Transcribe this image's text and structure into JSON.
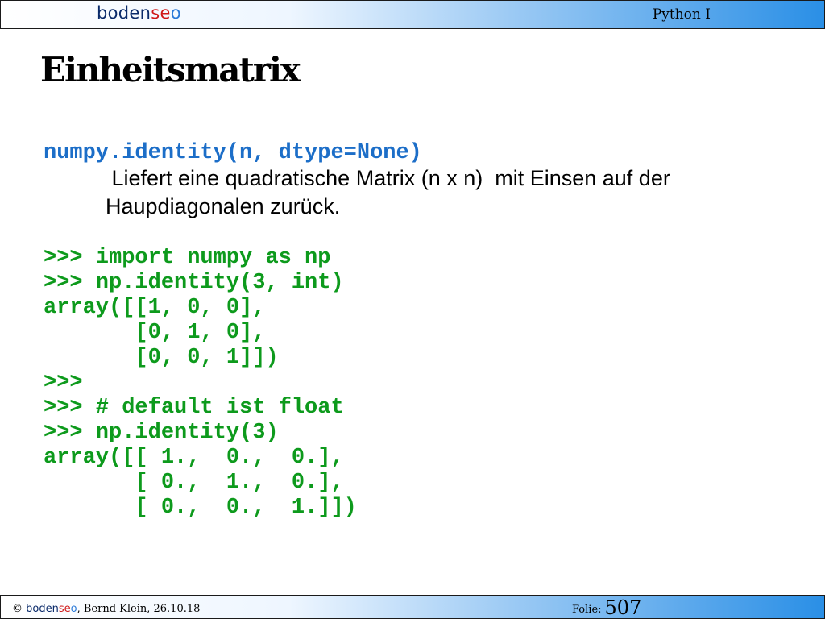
{
  "header": {
    "brand": {
      "part1": "boden",
      "part2": "se",
      "part3": "o"
    },
    "course": "Python I"
  },
  "slide": {
    "title": "Einheitsmatrix",
    "signature": "numpy.identity(n, dtype=None)",
    "description_lines": [
      " Liefert eine quadratische Matrix (n x n)  mit Einsen auf der",
      "Haupdiagonalen zurück."
    ],
    "code_lines": [
      ">>> import numpy as np",
      ">>> np.identity(3, int)",
      "array([[1, 0, 0],",
      "       [0, 1, 0],",
      "       [0, 0, 1]])",
      ">>>",
      ">>> # default ist float",
      ">>> np.identity(3)",
      "array([[ 1.,  0.,  0.],",
      "       [ 0.,  1.,  0.],",
      "       [ 0.,  0.,  1.]])"
    ]
  },
  "footer": {
    "copyright_symbol": "©",
    "brand": {
      "part1": "boden",
      "part2": "se",
      "part3": "o"
    },
    "author_date": ", Bernd Klein, 26.10.18",
    "folio_label": "Folie:",
    "folio_number": "507"
  },
  "colors": {
    "signature": "#1c6ec8",
    "code": "#0d9a1c",
    "brand_dark": "#0a2a6a",
    "brand_red": "#d01818",
    "brand_blue": "#2a7ad8",
    "bar_gradient_end": "#2a8fe6"
  }
}
